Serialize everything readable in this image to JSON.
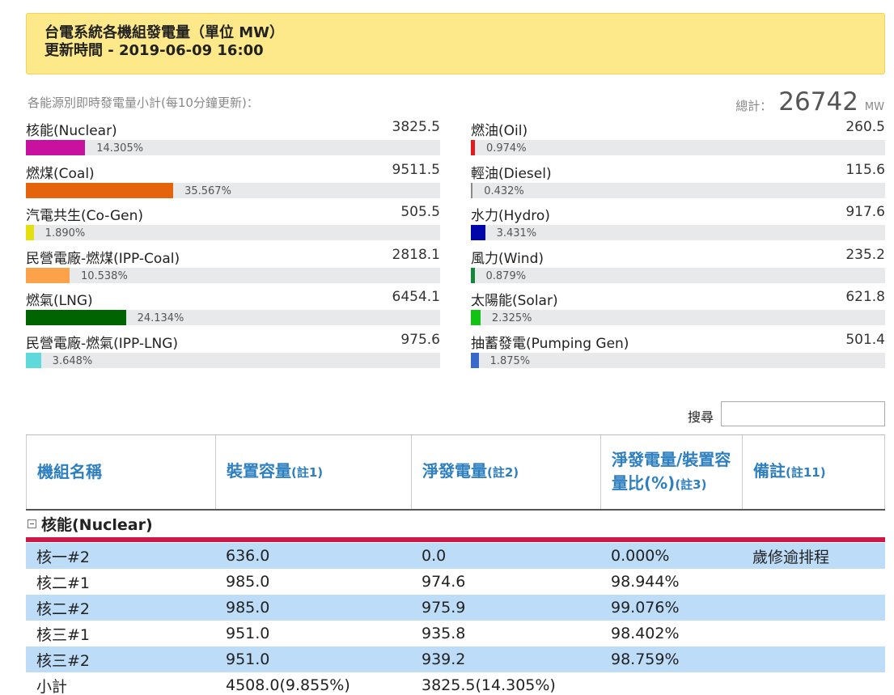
{
  "header": {
    "title": "台電系統各機組發電量（單位 MW）",
    "updated": "更新時間 - 2019-06-09 16:00"
  },
  "summary": {
    "subtitle": "各能源別即時發電量小計(每10分鐘更新)：",
    "total_label": "總計：",
    "total_value": "26742",
    "total_unit": "MW"
  },
  "energy_left": [
    {
      "name": "核能(Nuclear)",
      "value": "3825.5",
      "percent": "14.305%",
      "fill": 14.305,
      "color": "#c8119f"
    },
    {
      "name": "燃煤(Coal)",
      "value": "9511.5",
      "percent": "35.567%",
      "fill": 35.567,
      "color": "#e5630b"
    },
    {
      "name": "汽電共生(Co-Gen)",
      "value": "505.5",
      "percent": "1.890%",
      "fill": 1.89,
      "color": "#e3df10"
    },
    {
      "name": "民營電廠-燃煤(IPP-Coal)",
      "value": "2818.1",
      "percent": "10.538%",
      "fill": 10.538,
      "color": "#fba24b"
    },
    {
      "name": "燃氣(LNG)",
      "value": "6454.1",
      "percent": "24.134%",
      "fill": 24.134,
      "color": "#006500"
    },
    {
      "name": "民營電廠-燃氣(IPP-LNG)",
      "value": "975.6",
      "percent": "3.648%",
      "fill": 3.648,
      "color": "#5fd9dc"
    }
  ],
  "energy_right": [
    {
      "name": "燃油(Oil)",
      "value": "260.5",
      "percent": "0.974%",
      "fill": 0.974,
      "color": "#e51b1b"
    },
    {
      "name": "輕油(Diesel)",
      "value": "115.6",
      "percent": "0.432%",
      "fill": 0.432,
      "color": "#8a8a8a"
    },
    {
      "name": "水力(Hydro)",
      "value": "917.6",
      "percent": "3.431%",
      "fill": 3.431,
      "color": "#0006a8"
    },
    {
      "name": "風力(Wind)",
      "value": "235.2",
      "percent": "0.879%",
      "fill": 0.879,
      "color": "#108a3a"
    },
    {
      "name": "太陽能(Solar)",
      "value": "621.8",
      "percent": "2.325%",
      "fill": 2.325,
      "color": "#13c313"
    },
    {
      "name": "抽蓄發電(Pumping Gen)",
      "value": "501.4",
      "percent": "1.875%",
      "fill": 1.875,
      "color": "#3868c8"
    }
  ],
  "search": {
    "label": "搜尋",
    "value": ""
  },
  "table": {
    "headers": [
      {
        "text": "機組名稱",
        "note": ""
      },
      {
        "text": "裝置容量",
        "note": "(註1)"
      },
      {
        "text": "淨發電量",
        "note": "(註2)"
      },
      {
        "text": "淨發電量/裝置容量比(%)",
        "note": "(註3)"
      },
      {
        "text": "備註",
        "note": "(註11)"
      }
    ],
    "group": "核能(Nuclear)",
    "rows": [
      {
        "name": "核一#2",
        "capacity": "636.0",
        "net": "0.0",
        "ratio": "0.000%",
        "note": "歲修逾排程"
      },
      {
        "name": "核二#1",
        "capacity": "985.0",
        "net": "974.6",
        "ratio": "98.944%",
        "note": ""
      },
      {
        "name": "核二#2",
        "capacity": "985.0",
        "net": "975.9",
        "ratio": "99.076%",
        "note": ""
      },
      {
        "name": "核三#1",
        "capacity": "951.0",
        "net": "935.8",
        "ratio": "98.402%",
        "note": ""
      },
      {
        "name": "核三#2",
        "capacity": "951.0",
        "net": "939.2",
        "ratio": "98.759%",
        "note": ""
      },
      {
        "name": "小計",
        "capacity": "4508.0(9.855%)",
        "net": "3825.5(14.305%)",
        "ratio": "",
        "note": ""
      }
    ]
  }
}
